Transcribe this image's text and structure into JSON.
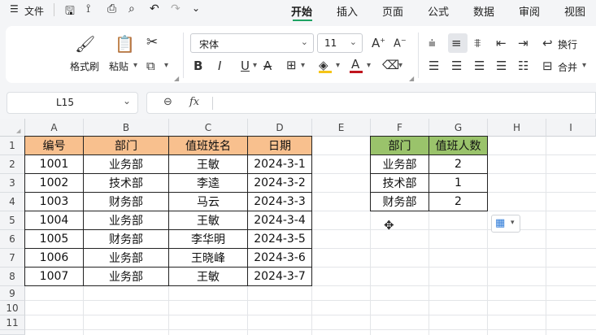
{
  "menubar": {
    "menu_icon": "hamburger-icon",
    "file_label": "文件",
    "tabs": [
      "开始",
      "插入",
      "页面",
      "公式",
      "数据",
      "审阅",
      "视图"
    ],
    "active_tab": "开始"
  },
  "ribbon": {
    "format_painter": "格式刷",
    "paste": "粘贴",
    "font_name": "宋体",
    "font_size": "11",
    "wrap": "换行",
    "merge": "合并"
  },
  "formula_bar": {
    "cell_ref": "L15",
    "fx": "fx",
    "formula": ""
  },
  "grid": {
    "columns": [
      "A",
      "B",
      "C",
      "D",
      "E",
      "F",
      "G",
      "H",
      "I"
    ],
    "rows": [
      "1",
      "2",
      "3",
      "4",
      "5",
      "6",
      "7",
      "8",
      "9",
      "10",
      "11"
    ],
    "table1": {
      "headers": [
        "编号",
        "部门",
        "值班姓名",
        "日期"
      ],
      "rows": [
        [
          "1001",
          "业务部",
          "王敏",
          "2024-3-1"
        ],
        [
          "1002",
          "技术部",
          "李逵",
          "2024-3-2"
        ],
        [
          "1003",
          "财务部",
          "马云",
          "2024-3-3"
        ],
        [
          "1004",
          "业务部",
          "王敏",
          "2024-3-4"
        ],
        [
          "1005",
          "财务部",
          "李华明",
          "2024-3-5"
        ],
        [
          "1006",
          "业务部",
          "王晓峰",
          "2024-3-6"
        ],
        [
          "1007",
          "业务部",
          "王敏",
          "2024-3-7"
        ]
      ]
    },
    "table2": {
      "headers": [
        "部门",
        "值班人数"
      ],
      "rows": [
        [
          "业务部",
          "2"
        ],
        [
          "技术部",
          "1"
        ],
        [
          "财务部",
          "2"
        ]
      ]
    }
  },
  "colors": {
    "accent": "#1ea363",
    "header_orange": "#f8c08e",
    "header_green": "#9ac36b"
  }
}
